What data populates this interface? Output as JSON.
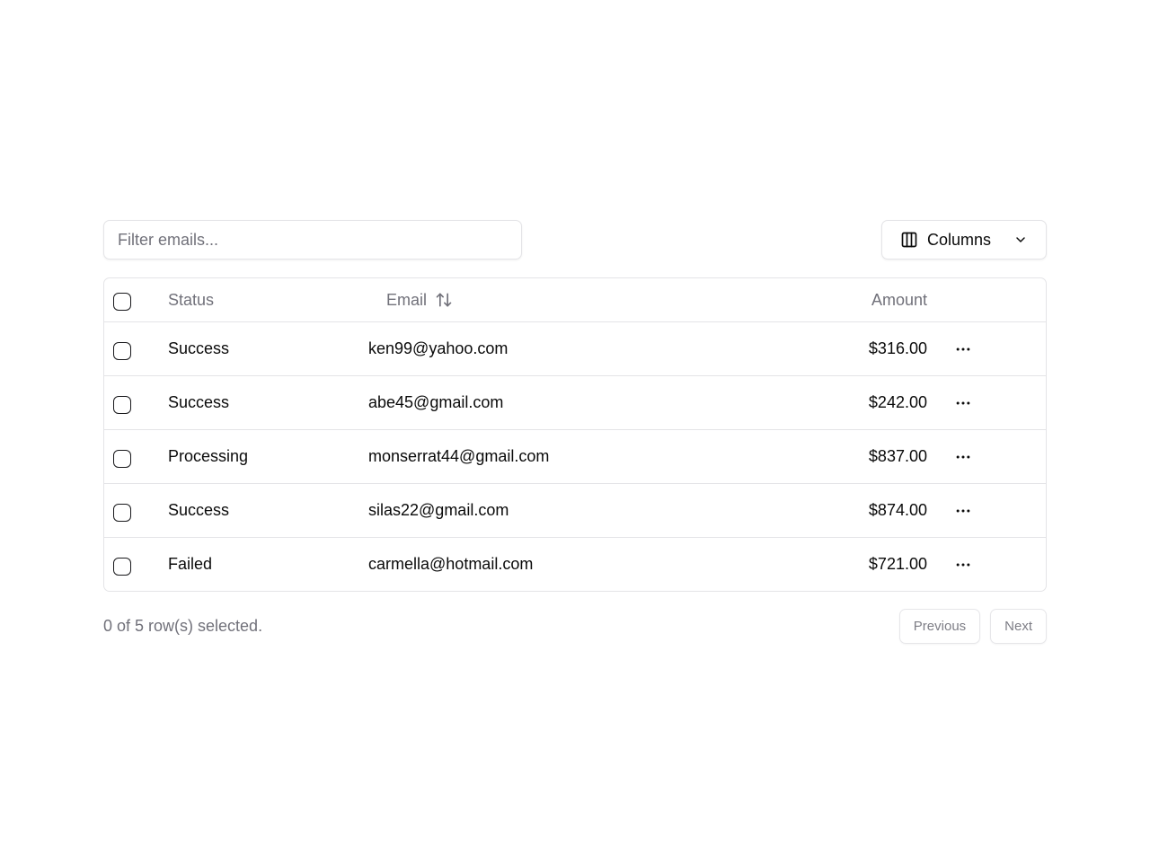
{
  "filter": {
    "placeholder": "Filter emails...",
    "value": ""
  },
  "columns_button": {
    "label": "Columns",
    "icon": "columns-icon"
  },
  "table": {
    "headers": {
      "status": "Status",
      "email": "Email",
      "amount": "Amount"
    },
    "rows": [
      {
        "status": "Success",
        "email": "ken99@yahoo.com",
        "amount": "$316.00"
      },
      {
        "status": "Success",
        "email": "abe45@gmail.com",
        "amount": "$242.00"
      },
      {
        "status": "Processing",
        "email": "monserrat44@gmail.com",
        "amount": "$837.00"
      },
      {
        "status": "Success",
        "email": "silas22@gmail.com",
        "amount": "$874.00"
      },
      {
        "status": "Failed",
        "email": "carmella@hotmail.com",
        "amount": "$721.00"
      }
    ]
  },
  "footer": {
    "selection_text": "0 of 5 row(s) selected.",
    "previous_label": "Previous",
    "next_label": "Next"
  },
  "colors": {
    "border": "#e4e4e7",
    "muted": "#71717a",
    "text": "#0a0a0a"
  }
}
